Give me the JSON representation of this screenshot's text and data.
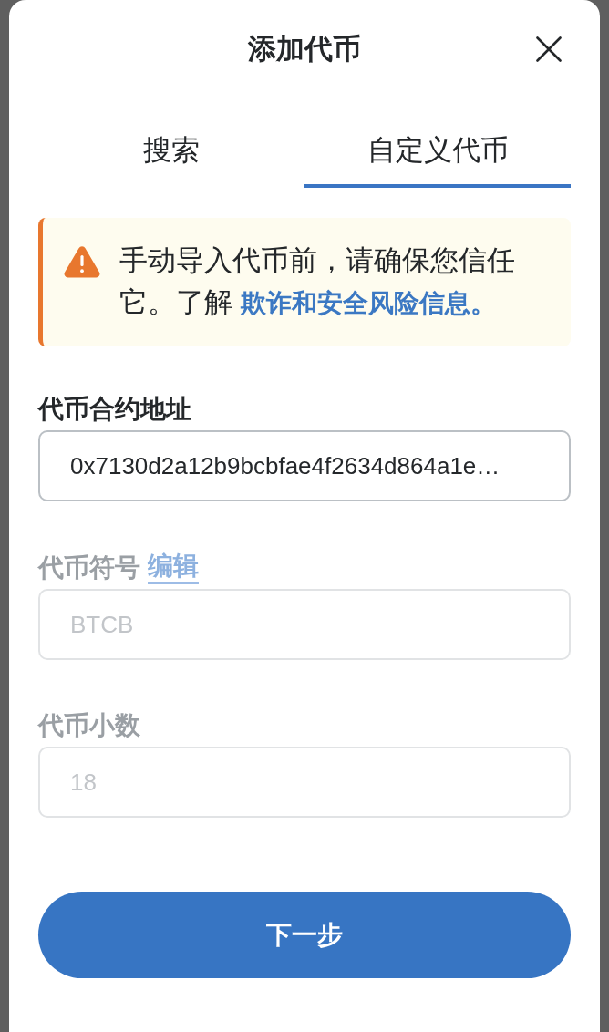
{
  "dialog": {
    "title": "添加代币"
  },
  "tabs": [
    {
      "label": "搜索",
      "selected": false
    },
    {
      "label": "自定义代币",
      "selected": true
    }
  ],
  "warning": {
    "text": "手动导入代币前，请确保您信任它。了解",
    "link": "欺诈和安全风险信息。"
  },
  "fields": [
    {
      "label": "代币合约地址",
      "value": "0x7130d2a12b9bcbfae4f2634d864a1e…",
      "disabled": false
    },
    {
      "label": "代币符号",
      "edit_link": "编辑",
      "value": "BTCB",
      "disabled": true
    },
    {
      "label": "代币小数",
      "value": "18",
      "disabled": true
    }
  ],
  "primary_button": {
    "label": "下一步"
  }
}
